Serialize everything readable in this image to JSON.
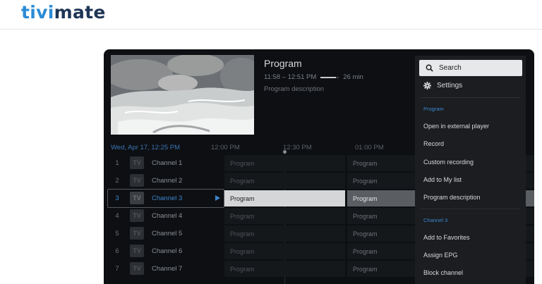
{
  "site": {
    "logo_brand": "tivi",
    "logo_rest": "mate"
  },
  "player": {
    "title": "Program",
    "time_range": "11:58 – 12:51 PM",
    "progress": 0.85,
    "duration": "26 min",
    "description": "Program description"
  },
  "timeline": {
    "date": "Wed, Apr 17, 12:25 PM",
    "times": [
      "12:00 PM",
      "12:30 PM",
      "01:00 PM"
    ]
  },
  "channels": [
    {
      "num": "1",
      "logo": "TV",
      "name": "Channel 1",
      "prog1": "Program",
      "prog2": "Program"
    },
    {
      "num": "2",
      "logo": "TV",
      "name": "Channel 2",
      "prog1": "Program",
      "prog2": "Program"
    },
    {
      "num": "3",
      "logo": "TV",
      "name": "Channel 3",
      "prog1": "Program",
      "prog2": "Program"
    },
    {
      "num": "4",
      "logo": "TV",
      "name": "Channel 4",
      "prog1": "Program",
      "prog2": "Program"
    },
    {
      "num": "5",
      "logo": "TV",
      "name": "Channel 5",
      "prog1": "Program",
      "prog2": "Program"
    },
    {
      "num": "6",
      "logo": "TV",
      "name": "Channel 6",
      "prog1": "Program",
      "prog2": "Program"
    },
    {
      "num": "7",
      "logo": "TV",
      "name": "Channel 7",
      "prog1": "Program",
      "prog2": "Program"
    }
  ],
  "menu": {
    "search": "Search",
    "settings": "Settings",
    "program_header": "Program",
    "program_items": [
      "Open in external player",
      "Record",
      "Custom recording",
      "Add to My list",
      "Program description"
    ],
    "channel_header": "Channel 3",
    "channel_items": [
      "Add to Favorites",
      "Assign EPG",
      "Block channel"
    ]
  },
  "colors": {
    "accent": "#3e86d0",
    "logo_blue": "#2a8bd6",
    "logo_dark": "#1e3556"
  }
}
